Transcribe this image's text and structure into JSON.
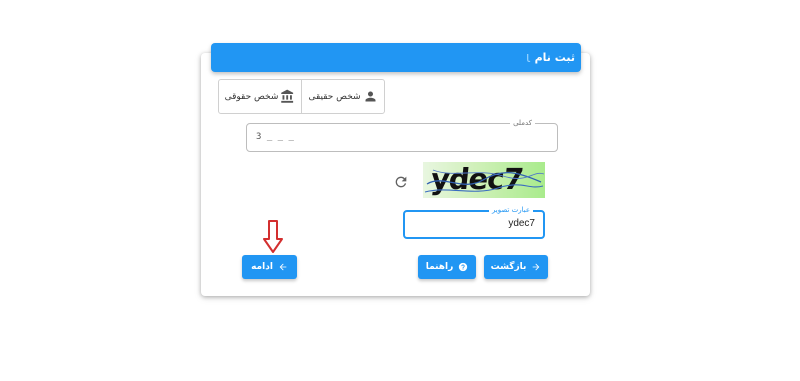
{
  "header": {
    "title": "ثبت نام"
  },
  "person_type": {
    "natural_label": "شخص حقیقی",
    "legal_label": "شخص حقوقی"
  },
  "national_code": {
    "label": "کدملی",
    "value": "3 _ _ _"
  },
  "captcha": {
    "image_text": "ydec7",
    "input_label": "عبارت تصویر",
    "input_value": "ydec7"
  },
  "actions": {
    "back_label": "بازگشت",
    "guide_label": "راهنما",
    "continue_label": "ادامه"
  },
  "colors": {
    "accent": "#2196f3",
    "hint_arrow": "#d32f2f"
  }
}
